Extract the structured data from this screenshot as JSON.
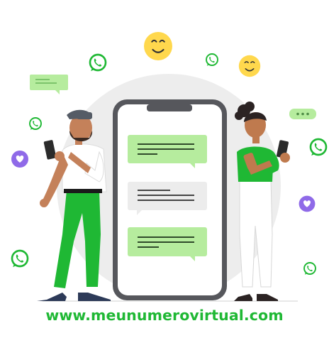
{
  "site": {
    "url_text": "www.meunumerovirtual.com"
  },
  "colors": {
    "brand_green": "#1fb834",
    "bubble_green": "#b6ec9e",
    "bubble_gray": "#ececec",
    "backdrop_gray": "#ededed",
    "phone_frame": "#56575c",
    "emoji_yellow": "#ffd84d",
    "heart_purple": "#8f6ae8",
    "skin_dark": "#bf7a4e",
    "hair_dark": "#2b2323"
  },
  "illustration": {
    "chat_bubbles": [
      "green",
      "gray",
      "green"
    ],
    "icons": [
      "whatsapp-icon",
      "smiley-icon",
      "heart-icon",
      "typing-dots-icon",
      "message-card-icon"
    ]
  }
}
